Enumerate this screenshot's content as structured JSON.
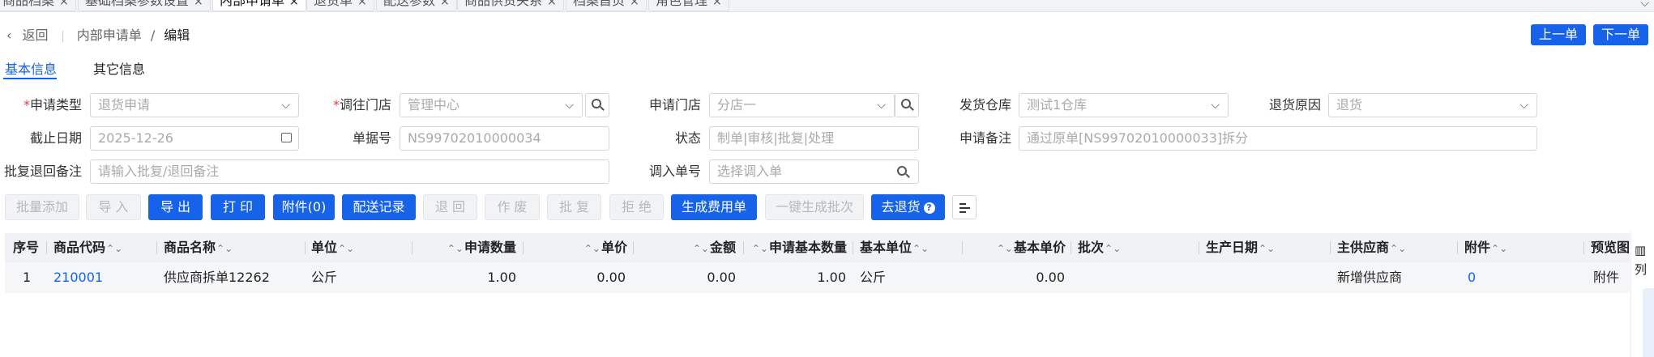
{
  "tabs": [
    {
      "label": "商品档案",
      "active": false
    },
    {
      "label": "基础档案参数设置",
      "active": false
    },
    {
      "label": "内部申请单",
      "active": true
    },
    {
      "label": "退货单",
      "active": false
    },
    {
      "label": "配送参数",
      "active": false
    },
    {
      "label": "商品供货关系",
      "active": false
    },
    {
      "label": "档案首页",
      "active": false
    },
    {
      "label": "角色管理",
      "active": false
    }
  ],
  "header": {
    "back": "返回",
    "crumb_parent": "内部申请单",
    "crumb_sep": "/",
    "crumb_current": "编辑",
    "prev": "上一单",
    "next": "下一单"
  },
  "subtabs": {
    "basic": "基本信息",
    "other": "其它信息"
  },
  "form": {
    "apply_type": {
      "label": "申请类型",
      "value": "退货申请"
    },
    "to_store": {
      "label": "调往门店",
      "value": "管理中心"
    },
    "apply_store": {
      "label": "申请门店",
      "value": "分店一"
    },
    "ship_warehouse": {
      "label": "发货仓库",
      "value": "测试1仓库"
    },
    "return_reason": {
      "label": "退货原因",
      "value": "退货"
    },
    "deadline": {
      "label": "截止日期",
      "value": "2025-12-26"
    },
    "doc_no": {
      "label": "单据号",
      "value": "NS99702010000034"
    },
    "status": {
      "label": "状态",
      "value": "制单|审核|批复|处理"
    },
    "apply_note": {
      "label": "申请备注",
      "value": "通过原单[NS99702010000033]拆分"
    },
    "reply_note": {
      "label": "批复退回备注",
      "placeholder": "请输入批复/退回备注"
    },
    "in_doc": {
      "label": "调入单号",
      "placeholder": "选择调入单"
    }
  },
  "toolbar": {
    "batch_add": "批量添加",
    "import": "导 入",
    "export": "导 出",
    "print": "打 印",
    "attach": "附件(0)",
    "delivery_log": "配送记录",
    "return": "退 回",
    "void": "作 废",
    "approve": "批 复",
    "reject": "拒 绝",
    "gen_fee": "生成费用单",
    "gen_batch": "一键生成批次",
    "go_return": "去退货",
    "help_glyph": "?"
  },
  "table": {
    "headers": [
      "序号",
      "商品代码",
      "商品名称",
      "单位",
      "申请数量",
      "单价",
      "金额",
      "申请基本数量",
      "基本单位",
      "基本单价",
      "批次",
      "生产日期",
      "主供应商",
      "附件",
      "预览图"
    ],
    "rows": [
      {
        "seq": "1",
        "code": "210001",
        "name": "供应商拆单12262",
        "unit": "公斤",
        "qty": "1.00",
        "price": "0.00",
        "amount": "0.00",
        "base_qty": "1.00",
        "base_unit": "公斤",
        "base_price": "0.00",
        "batch": "",
        "prod_date": "",
        "supplier": "新增供应商",
        "attach": "0",
        "preview": "附件"
      }
    ]
  },
  "side": {
    "icon_glyph": "▥",
    "label": "列"
  },
  "icons": {
    "chevron": "⌵",
    "close": "×",
    "back": "‹",
    "sort": "⌃⌄"
  },
  "colors": {
    "primary": "#1662e8",
    "required": "#e0393e"
  }
}
